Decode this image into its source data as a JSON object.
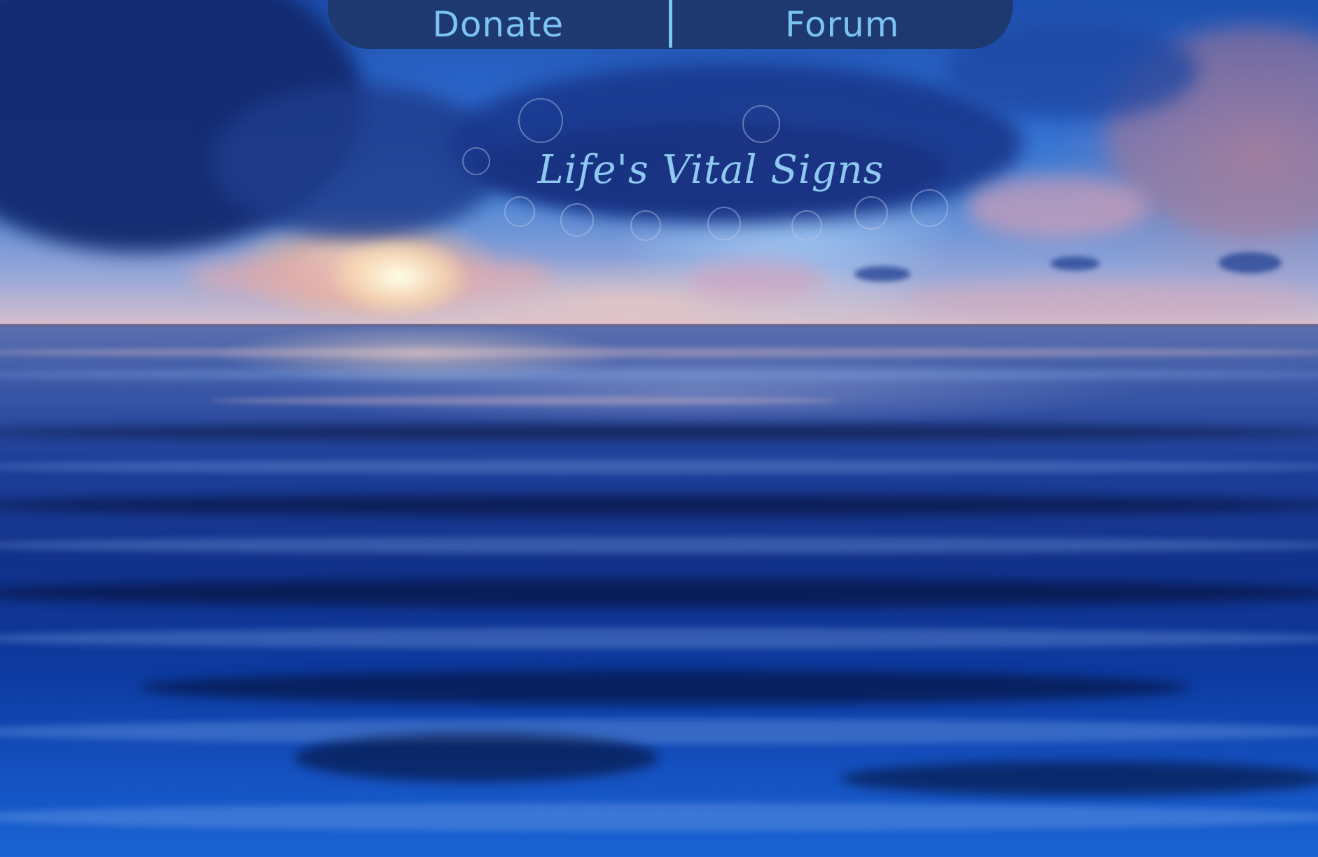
{
  "nav": {
    "items": [
      {
        "label": "Donate"
      },
      {
        "label": "Forum"
      }
    ]
  },
  "header": {
    "title": "Life's Vital Signs"
  },
  "colors": {
    "nav_background": "#1e3870",
    "nav_text": "#7cc4f4",
    "title_text": "#8fc9f2"
  }
}
